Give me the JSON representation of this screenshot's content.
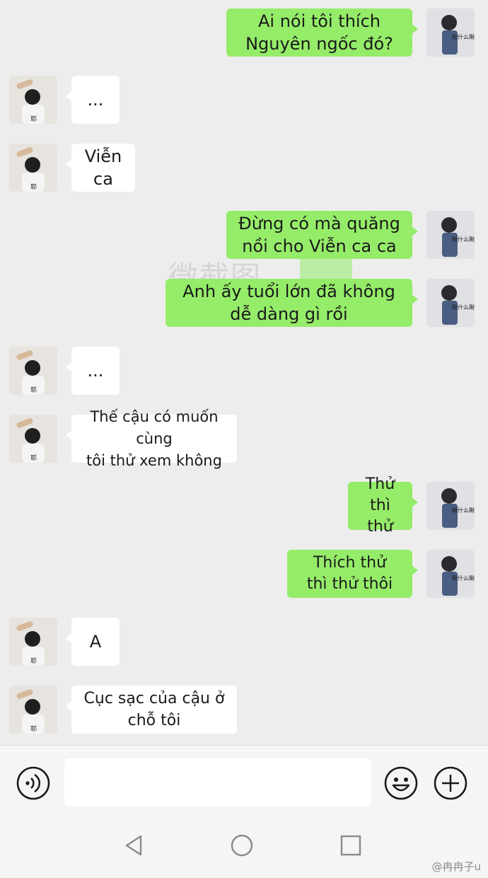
{
  "watermark": "微截图",
  "messages": [
    {
      "side": "right",
      "text": "Ai nói tôi thích\nNguyên ngốc đó?"
    },
    {
      "side": "left",
      "text": "..."
    },
    {
      "side": "left",
      "text": "Viễn ca"
    },
    {
      "side": "right",
      "text": "Đừng có mà quăng\nnồi cho Viễn ca ca"
    },
    {
      "side": "right",
      "text": "Anh ấy tuổi lớn đã không\ndễ dàng gì rồi"
    },
    {
      "side": "left",
      "text": "..."
    },
    {
      "side": "left",
      "text": "Thế cậu có muốn cùng\ntôi thử xem không"
    },
    {
      "side": "right",
      "text": "Thử thì\nthử"
    },
    {
      "side": "right",
      "text": "Thích thử\nthì thử thôi"
    },
    {
      "side": "left",
      "text": "A"
    },
    {
      "side": "left",
      "text": "Cục sạc của cậu ở\nchỗ tôi"
    }
  ],
  "sticker_caption": "瞅什么瞅?",
  "left_avatar_caption": "耶",
  "input": {
    "placeholder": ""
  },
  "icons": {
    "voice": "voice-icon",
    "emoji": "emoji-icon",
    "plus": "plus-icon",
    "back": "back-nav-icon",
    "home": "home-nav-icon",
    "recents": "recents-nav-icon"
  },
  "credit": "@冉冉子u",
  "colors": {
    "green_bubble": "#95ec69",
    "white_bubble": "#ffffff",
    "background": "#ededed"
  }
}
